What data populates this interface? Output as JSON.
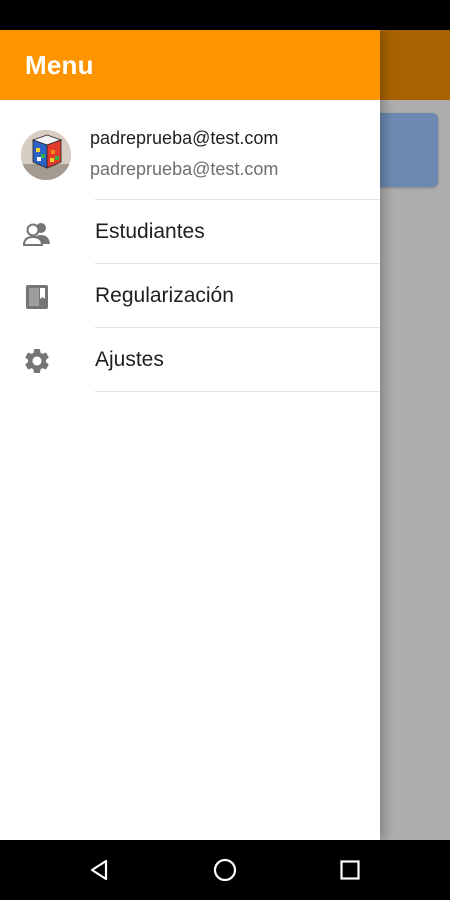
{
  "drawer": {
    "title": "Menu",
    "account": {
      "name": "padreprueba@test.com",
      "email": "padreprueba@test.com"
    },
    "items": [
      {
        "label": "Estudiantes",
        "icon": "people-icon"
      },
      {
        "label": "Regularización",
        "icon": "book-icon"
      },
      {
        "label": "Ajustes",
        "icon": "settings-icon"
      }
    ]
  },
  "nav": {
    "buttons": [
      "back-icon",
      "home-icon",
      "recents-icon"
    ]
  },
  "colors": {
    "header": "#fe9400",
    "icon": "#757575"
  }
}
